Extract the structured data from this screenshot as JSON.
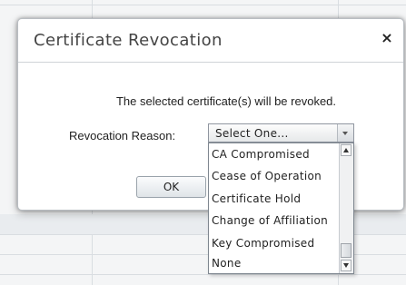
{
  "dialog": {
    "title": "Certificate Revocation",
    "close_label": "×",
    "message": "The selected certificate(s) will be revoked.",
    "reason_label": "Revocation Reason:",
    "ok_label": "OK"
  },
  "select": {
    "value": "Select One...",
    "options": [
      "CA Compromised",
      "Cease of Operation",
      "Certificate Hold",
      "Change of Affiliation",
      "Key Compromised",
      "None"
    ]
  },
  "colors": {
    "dialog_background": "#ffffff",
    "page_background": "#f4f5f6",
    "border": "#b9bec3"
  }
}
